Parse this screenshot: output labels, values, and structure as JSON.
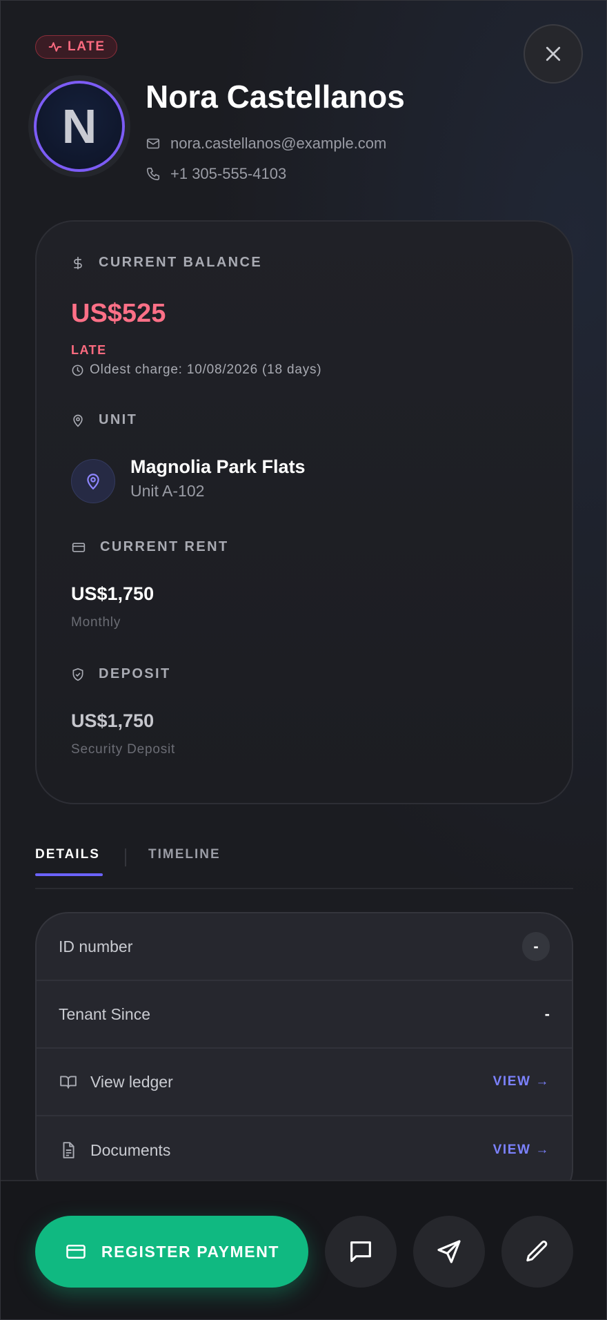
{
  "header": {
    "status": "LATE",
    "avatar_initial": "N",
    "name": "Nora Castellanos",
    "email": "nora.castellanos@example.com",
    "phone": "+1 305-555-4103"
  },
  "summary": {
    "balance_label": "CURRENT BALANCE",
    "balance_value": "US$525",
    "balance_status": "LATE",
    "oldest_charge": "Oldest charge: 10/08/2026 (18 days)",
    "unit_label": "UNIT",
    "unit_name": "Magnolia Park Flats",
    "unit_number": "Unit A-102",
    "rent_label": "CURRENT RENT",
    "rent_value": "US$1,750",
    "rent_period": "Monthly",
    "deposit_label": "DEPOSIT",
    "deposit_value": "US$1,750",
    "deposit_type": "Security Deposit"
  },
  "tabs": [
    {
      "label": "DETAILS",
      "active": true
    },
    {
      "label": "TIMELINE",
      "active": false
    }
  ],
  "details": {
    "id_label": "ID number",
    "id_value": "-",
    "tenant_since_label": "Tenant Since",
    "tenant_since_value": "-",
    "ledger_label": "View ledger",
    "ledger_action": "VIEW →",
    "documents_label": "Documents",
    "documents_action": "VIEW →"
  },
  "actions": {
    "register_payment": "REGISTER PAYMENT",
    "icons": [
      "message-icon",
      "send-icon",
      "edit-icon"
    ]
  },
  "colors": {
    "late": "#ff6b80",
    "accent": "#6c63ff",
    "primary_button": "#10b981",
    "link": "#7c82ff"
  }
}
